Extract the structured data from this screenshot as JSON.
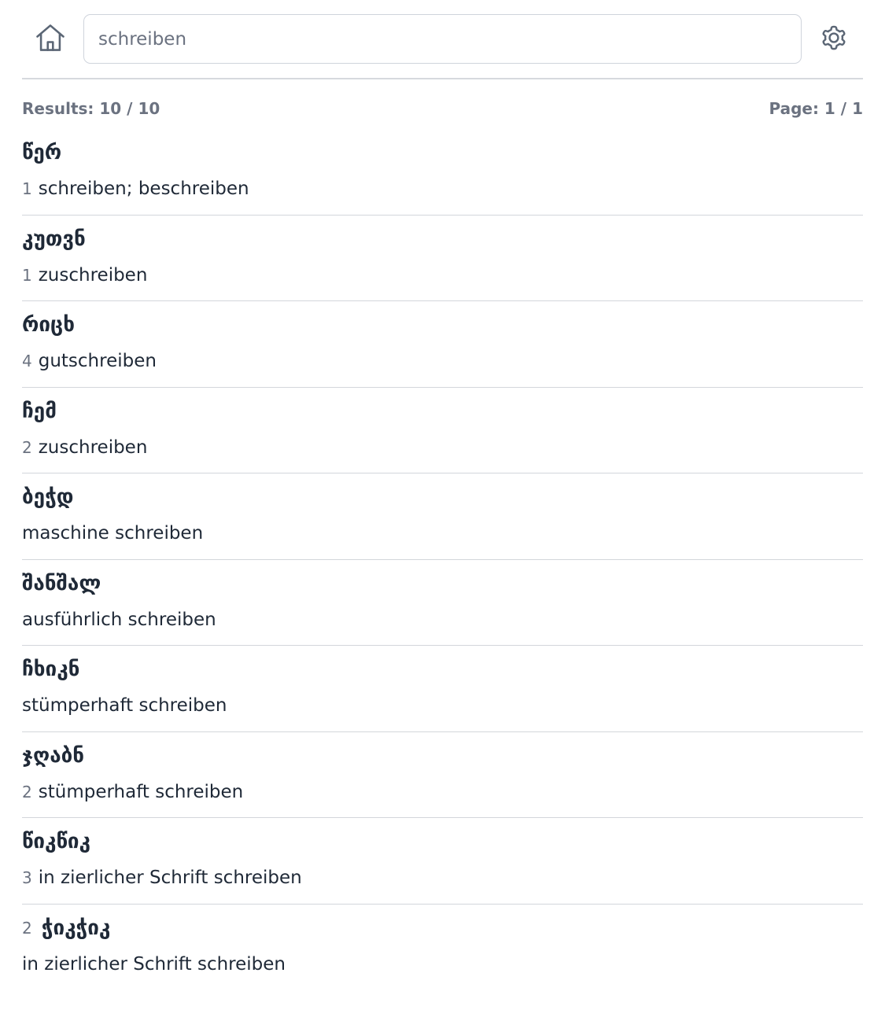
{
  "search": {
    "value": "schreiben"
  },
  "meta": {
    "results_label": "Results: 10 / 10",
    "page_label": "Page: 1 / 1"
  },
  "results": [
    {
      "headword_num": "",
      "headword": "წერ",
      "sense_num": "1",
      "translation": "schreiben; beschreiben"
    },
    {
      "headword_num": "",
      "headword": "კუთვნ",
      "sense_num": "1",
      "translation": "zuschreiben"
    },
    {
      "headword_num": "",
      "headword": "რიცხ",
      "sense_num": "4",
      "translation": "gutschreiben"
    },
    {
      "headword_num": "",
      "headword": "ჩემ",
      "sense_num": "2",
      "translation": "zuschreiben"
    },
    {
      "headword_num": "",
      "headword": "ბეჭდ",
      "sense_num": "",
      "translation": "maschine schreiben"
    },
    {
      "headword_num": "",
      "headword": "შანშალ",
      "sense_num": "",
      "translation": "ausführlich schreiben"
    },
    {
      "headword_num": "",
      "headword": "ჩხიკნ",
      "sense_num": "",
      "translation": "stümperhaft schreiben"
    },
    {
      "headword_num": "",
      "headword": "ჯღაბნ",
      "sense_num": "2",
      "translation": "stümperhaft schreiben"
    },
    {
      "headword_num": "",
      "headword": "წიკწიკ",
      "sense_num": "3",
      "translation": "in zierlicher Schrift schreiben"
    },
    {
      "headword_num": "2",
      "headword": "ჭიკჭიკ",
      "sense_num": "",
      "translation": "in zierlicher Schrift schreiben"
    }
  ],
  "icons": {
    "home": "home-icon",
    "settings": "gear-icon"
  },
  "colors": {
    "icon": "#5b6675",
    "divider": "#d3d6db",
    "muted_text": "#6b7280"
  }
}
